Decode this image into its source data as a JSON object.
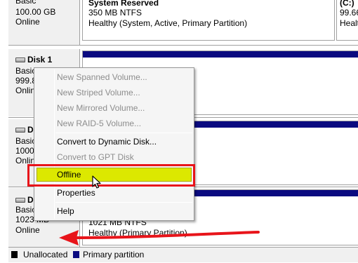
{
  "disk0": {
    "type_label": "Basic",
    "size": "100.00 GB",
    "status": "Online"
  },
  "partition_system_reserved": {
    "name": "System Reserved",
    "size_fs": "350 MB NTFS",
    "status": "Healthy (System, Active, Primary Partition)"
  },
  "partition_c": {
    "name": "(C:)",
    "size_fs": "99.66",
    "status": "Healt"
  },
  "disk1": {
    "title": "Disk 1",
    "type_label": "Basic",
    "size": "999.8",
    "status": "Onlin"
  },
  "disk2": {
    "title": "D",
    "type_label": "Basic",
    "size": "1000",
    "status": "Onlin"
  },
  "disk3": {
    "title": "D",
    "type_label": "Basic",
    "size": "1023 MB",
    "status": "Online"
  },
  "partition_disk3": {
    "size_fs": "1021 MB NTFS",
    "status": "Healthy (Primary Partition)"
  },
  "context_menu": {
    "items": [
      {
        "label": "New Spanned Volume...",
        "enabled": false
      },
      {
        "label": "New Striped Volume...",
        "enabled": false
      },
      {
        "label": "New Mirrored Volume...",
        "enabled": false
      },
      {
        "label": "New RAID-5 Volume...",
        "enabled": false
      },
      {
        "label": "Convert to Dynamic Disk...",
        "enabled": true
      },
      {
        "label": "Convert to GPT Disk",
        "enabled": false
      },
      {
        "label": "Offline",
        "enabled": true,
        "highlighted": true
      },
      {
        "label": "Properties",
        "enabled": true
      },
      {
        "label": "Help",
        "enabled": true
      }
    ]
  },
  "legend": {
    "unallocated": "Unallocated",
    "primary": "Primary partition"
  },
  "colors": {
    "primary_partition": "#0a0a80",
    "unallocated": "#000000",
    "highlight": "#dce800",
    "annotation_red": "#e8141a"
  }
}
